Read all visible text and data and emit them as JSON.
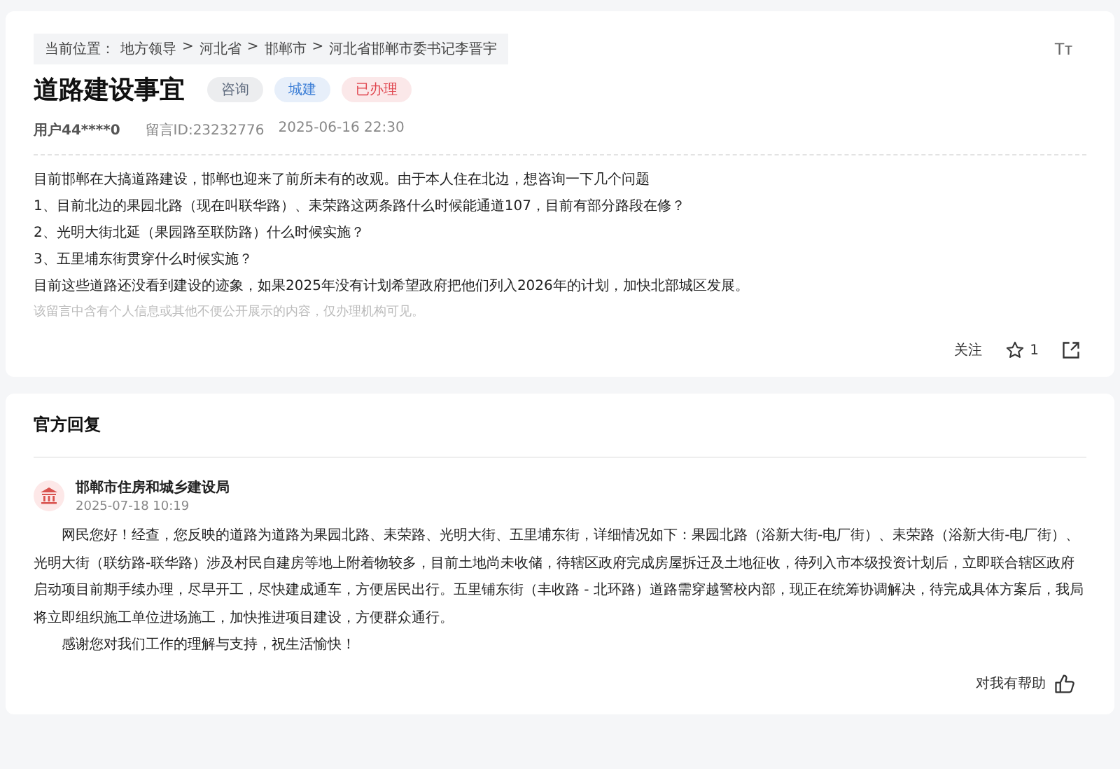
{
  "breadcrumb": {
    "prefix": "当前位置：",
    "items": [
      "地方领导",
      "河北省",
      "邯郸市",
      "河北省邯郸市委书记李晋宇"
    ],
    "separator": ">"
  },
  "font_size_toggle": "Tт",
  "question": {
    "title": "道路建设事宜",
    "tags": [
      {
        "label": "咨询",
        "color": "#5f6b7e"
      },
      {
        "label": "城建",
        "color": "#3d7fd6"
      },
      {
        "label": "已办理",
        "color": "#e0454e"
      }
    ],
    "user": "用户44****0",
    "message_id": "留言ID:23232776",
    "time": "2025-06-16 22:30",
    "body": [
      "目前邯郸在大搞道路建设，邯郸也迎来了前所未有的改观。由于本人住在北边，想咨询一下几个问题",
      "1、目前北边的果园北路（现在叫联华路）、耒荣路这两条路什么时候能通道107，目前有部分路段在修？",
      "2、光明大街北延（果园路至联防路）什么时候实施？",
      "3、五里埔东街贯穿什么时候实施？",
      "目前这些道路还没看到建设的迹象，如果2025年没有计划希望政府把他们列入2026年的计划，加快北部城区发展。"
    ],
    "privacy_note": "该留言中含有个人信息或其他不便公开展示的内容，仅办理机构可见。",
    "follow": "关注",
    "likes": "1"
  },
  "reply": {
    "heading": "官方回复",
    "department": "邯郸市住房和城乡建设局",
    "time": "2025-07-18 10:19",
    "paragraphs": [
      "网民您好！经查，您反映的道路为道路为果园北路、耒荣路、光明大街、五里埔东街，详细情况如下：果园北路（浴新大街-电厂街）、耒荣路（浴新大街-电厂街）、光明大街（联纺路-联华路）涉及村民自建房等地上附着物较多，目前土地尚未收储，待辖区政府完成房屋拆迁及土地征收，待列入市本级投资计划后，立即联合辖区政府启动项目前期手续办理，尽早开工，尽快建成通车，方便居民出行。五里铺东街（丰收路 - 北环路）道路需穿越警校内部，现正在统筹协调解决，待完成具体方案后，我局将立即组织施工单位进场施工，加快推进项目建设，方便群众通行。",
      "感谢您对我们工作的理解与支持，祝生活愉快！"
    ],
    "helpful": "对我有帮助"
  }
}
